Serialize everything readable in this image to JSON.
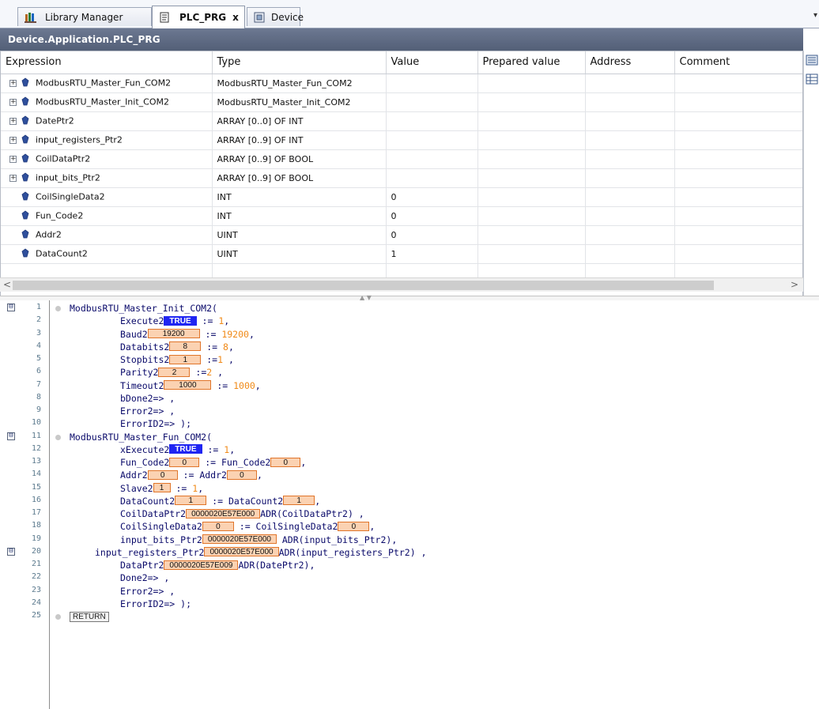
{
  "tabs": [
    {
      "label": "Library Manager",
      "icon": "library-icon"
    },
    {
      "label": "PLC_PRG",
      "icon": "document-icon",
      "close": "x",
      "active": true
    },
    {
      "label": "Device",
      "icon": "device-icon"
    }
  ],
  "tab_menu_glyph": "▾",
  "title": "Device.Application.PLC_PRG",
  "watch": {
    "columns": [
      "Expression",
      "Type",
      "Value",
      "Prepared value",
      "Address",
      "Comment"
    ],
    "rows": [
      {
        "expander": "+",
        "expression": "ModbusRTU_Master_Fun_COM2",
        "type": "ModbusRTU_Master_Fun_COM2",
        "value": ""
      },
      {
        "expander": "+",
        "expression": "ModbusRTU_Master_Init_COM2",
        "type": "ModbusRTU_Master_Init_COM2",
        "value": ""
      },
      {
        "expander": "+",
        "expression": "DatePtr2",
        "type": "ARRAY [0..0] OF INT",
        "value": ""
      },
      {
        "expander": "+",
        "expression": "input_registers_Ptr2",
        "type": "ARRAY [0..9] OF INT",
        "value": ""
      },
      {
        "expander": "+",
        "expression": "CoilDataPtr2",
        "type": "ARRAY [0..9] OF BOOL",
        "value": ""
      },
      {
        "expander": "+",
        "expression": "input_bits_Ptr2",
        "type": "ARRAY [0..9] OF BOOL",
        "value": ""
      },
      {
        "expander": "",
        "expression": "CoilSingleData2",
        "type": "INT",
        "value": "0"
      },
      {
        "expander": "",
        "expression": "Fun_Code2",
        "type": "INT",
        "value": "0"
      },
      {
        "expander": "",
        "expression": "Addr2",
        "type": "UINT",
        "value": "0"
      },
      {
        "expander": "",
        "expression": "DataCount2",
        "type": "UINT",
        "value": "1"
      }
    ],
    "scroll_left": "<",
    "scroll_right": ">"
  },
  "colors": {
    "monitor_orange_bg": "#fbd2b2",
    "monitor_orange_border": "#e0752a",
    "monitor_true_bg": "#1f25f2",
    "number_literal": "#f08a18",
    "code_text": "#0a0a6a"
  },
  "code": [
    {
      "n": "1",
      "fold": "⊟",
      "bp": true,
      "indent": 0,
      "tokens": [
        {
          "t": "ModbusRTU_Master_Init_COM2("
        }
      ]
    },
    {
      "n": "2",
      "indent": 2,
      "tokens": [
        {
          "t": "Execute2"
        },
        {
          "mv": "TRUE",
          "style": "blue"
        },
        {
          "t": " := "
        },
        {
          "num": "1"
        },
        {
          "t": ","
        }
      ]
    },
    {
      "n": "3",
      "indent": 2,
      "tokens": [
        {
          "t": "Baud2"
        },
        {
          "mv": "19200",
          "style": "orange",
          "w": 66
        },
        {
          "t": " := "
        },
        {
          "num": "19200"
        },
        {
          "t": ","
        }
      ]
    },
    {
      "n": "4",
      "indent": 2,
      "tokens": [
        {
          "t": "Databits2"
        },
        {
          "mv": "8",
          "style": "orange",
          "w": 40
        },
        {
          "t": " := "
        },
        {
          "num": "8"
        },
        {
          "t": ","
        }
      ]
    },
    {
      "n": "5",
      "indent": 2,
      "tokens": [
        {
          "t": "Stopbits2"
        },
        {
          "mv": "1",
          "style": "orange",
          "w": 40
        },
        {
          "t": " :="
        },
        {
          "num": "1"
        },
        {
          "t": " ,"
        }
      ]
    },
    {
      "n": "6",
      "indent": 2,
      "tokens": [
        {
          "t": "Parity2"
        },
        {
          "mv": "2",
          "style": "orange",
          "w": 40
        },
        {
          "t": " :="
        },
        {
          "num": "2"
        },
        {
          "t": " ,"
        }
      ]
    },
    {
      "n": "7",
      "indent": 2,
      "tokens": [
        {
          "t": "Timeout2"
        },
        {
          "mv": "1000",
          "style": "orange",
          "w": 60
        },
        {
          "t": " := "
        },
        {
          "num": "1000"
        },
        {
          "t": ","
        }
      ]
    },
    {
      "n": "8",
      "indent": 2,
      "tokens": [
        {
          "t": "bDone2=> ,"
        }
      ]
    },
    {
      "n": "9",
      "indent": 2,
      "tokens": [
        {
          "t": "Error2=> ,"
        }
      ]
    },
    {
      "n": "10",
      "indent": 2,
      "tokens": [
        {
          "t": "ErrorID2=> );"
        }
      ]
    },
    {
      "n": "11",
      "fold": "⊟",
      "bp": true,
      "indent": 0,
      "tokens": [
        {
          "t": "ModbusRTU_Master_Fun_COM2("
        }
      ]
    },
    {
      "n": "12",
      "indent": 2,
      "tokens": [
        {
          "t": "xExecute2"
        },
        {
          "mv": "TRUE",
          "style": "blue"
        },
        {
          "t": " := "
        },
        {
          "num": "1"
        },
        {
          "t": ","
        }
      ]
    },
    {
      "n": "13",
      "indent": 2,
      "tokens": [
        {
          "t": "Fun_Code2"
        },
        {
          "mv": "0",
          "style": "orange",
          "w": 38
        },
        {
          "t": " := Fun_Code2"
        },
        {
          "mv": "0",
          "style": "orange",
          "w": 38
        },
        {
          "t": ","
        }
      ]
    },
    {
      "n": "14",
      "indent": 2,
      "tokens": [
        {
          "t": "Addr2"
        },
        {
          "mv": "0",
          "style": "orange",
          "w": 38
        },
        {
          "t": " := Addr2"
        },
        {
          "mv": "0",
          "style": "orange",
          "w": 38
        },
        {
          "t": ","
        }
      ]
    },
    {
      "n": "15",
      "indent": 2,
      "tokens": [
        {
          "t": "Slave2"
        },
        {
          "mv": "1",
          "style": "orange",
          "w": 22
        },
        {
          "t": " := "
        },
        {
          "num": "1"
        },
        {
          "t": ","
        }
      ]
    },
    {
      "n": "16",
      "indent": 2,
      "tokens": [
        {
          "t": "DataCount2"
        },
        {
          "mv": "1",
          "style": "orange",
          "w": 40
        },
        {
          "t": " := DataCount2"
        },
        {
          "mv": "1",
          "style": "orange",
          "w": 40
        },
        {
          "t": ","
        }
      ]
    },
    {
      "n": "17",
      "indent": 2,
      "tokens": [
        {
          "t": "CoilDataPtr2"
        },
        {
          "mv": "0000020E57E000",
          "style": "orange",
          "w": 82
        },
        {
          "t": "ADR(CoilDataPtr2) ,"
        }
      ]
    },
    {
      "n": "18",
      "indent": 2,
      "tokens": [
        {
          "t": "CoilSingleData2"
        },
        {
          "mv": "0",
          "style": "orange",
          "w": 40
        },
        {
          "t": " := CoilSingleData2"
        },
        {
          "mv": "0",
          "style": "orange",
          "w": 40
        },
        {
          "t": ","
        }
      ]
    },
    {
      "n": "19",
      "indent": 2,
      "tokens": [
        {
          "t": "input_bits_Ptr2"
        },
        {
          "mv": "0000020E57E000",
          "style": "orange",
          "w": 82
        },
        {
          "t": " ADR(input_bits_Ptr2),"
        }
      ]
    },
    {
      "n": "20",
      "fold": "⊟",
      "indent": 1,
      "tokens": [
        {
          "t": "input_registers_Ptr2"
        },
        {
          "mv": "0000020E57E000",
          "style": "orange",
          "w": 82
        },
        {
          "t": "ADR(input_registers_Ptr2) ,"
        }
      ]
    },
    {
      "n": "21",
      "indent": 2,
      "tokens": [
        {
          "t": "DataPtr2"
        },
        {
          "mv": "0000020E57E009",
          "style": "orange",
          "w": 82
        },
        {
          "t": "ADR(DatePtr2),"
        }
      ]
    },
    {
      "n": "22",
      "indent": 2,
      "tokens": [
        {
          "t": "Done2=> ,"
        }
      ]
    },
    {
      "n": "23",
      "indent": 2,
      "tokens": [
        {
          "t": "Error2=> ,"
        }
      ]
    },
    {
      "n": "24",
      "indent": 2,
      "tokens": [
        {
          "t": "ErrorID2=> );"
        }
      ]
    },
    {
      "n": "25",
      "bp": true,
      "indent": 0,
      "tokens": [
        {
          "ret": "RETURN"
        }
      ]
    }
  ]
}
